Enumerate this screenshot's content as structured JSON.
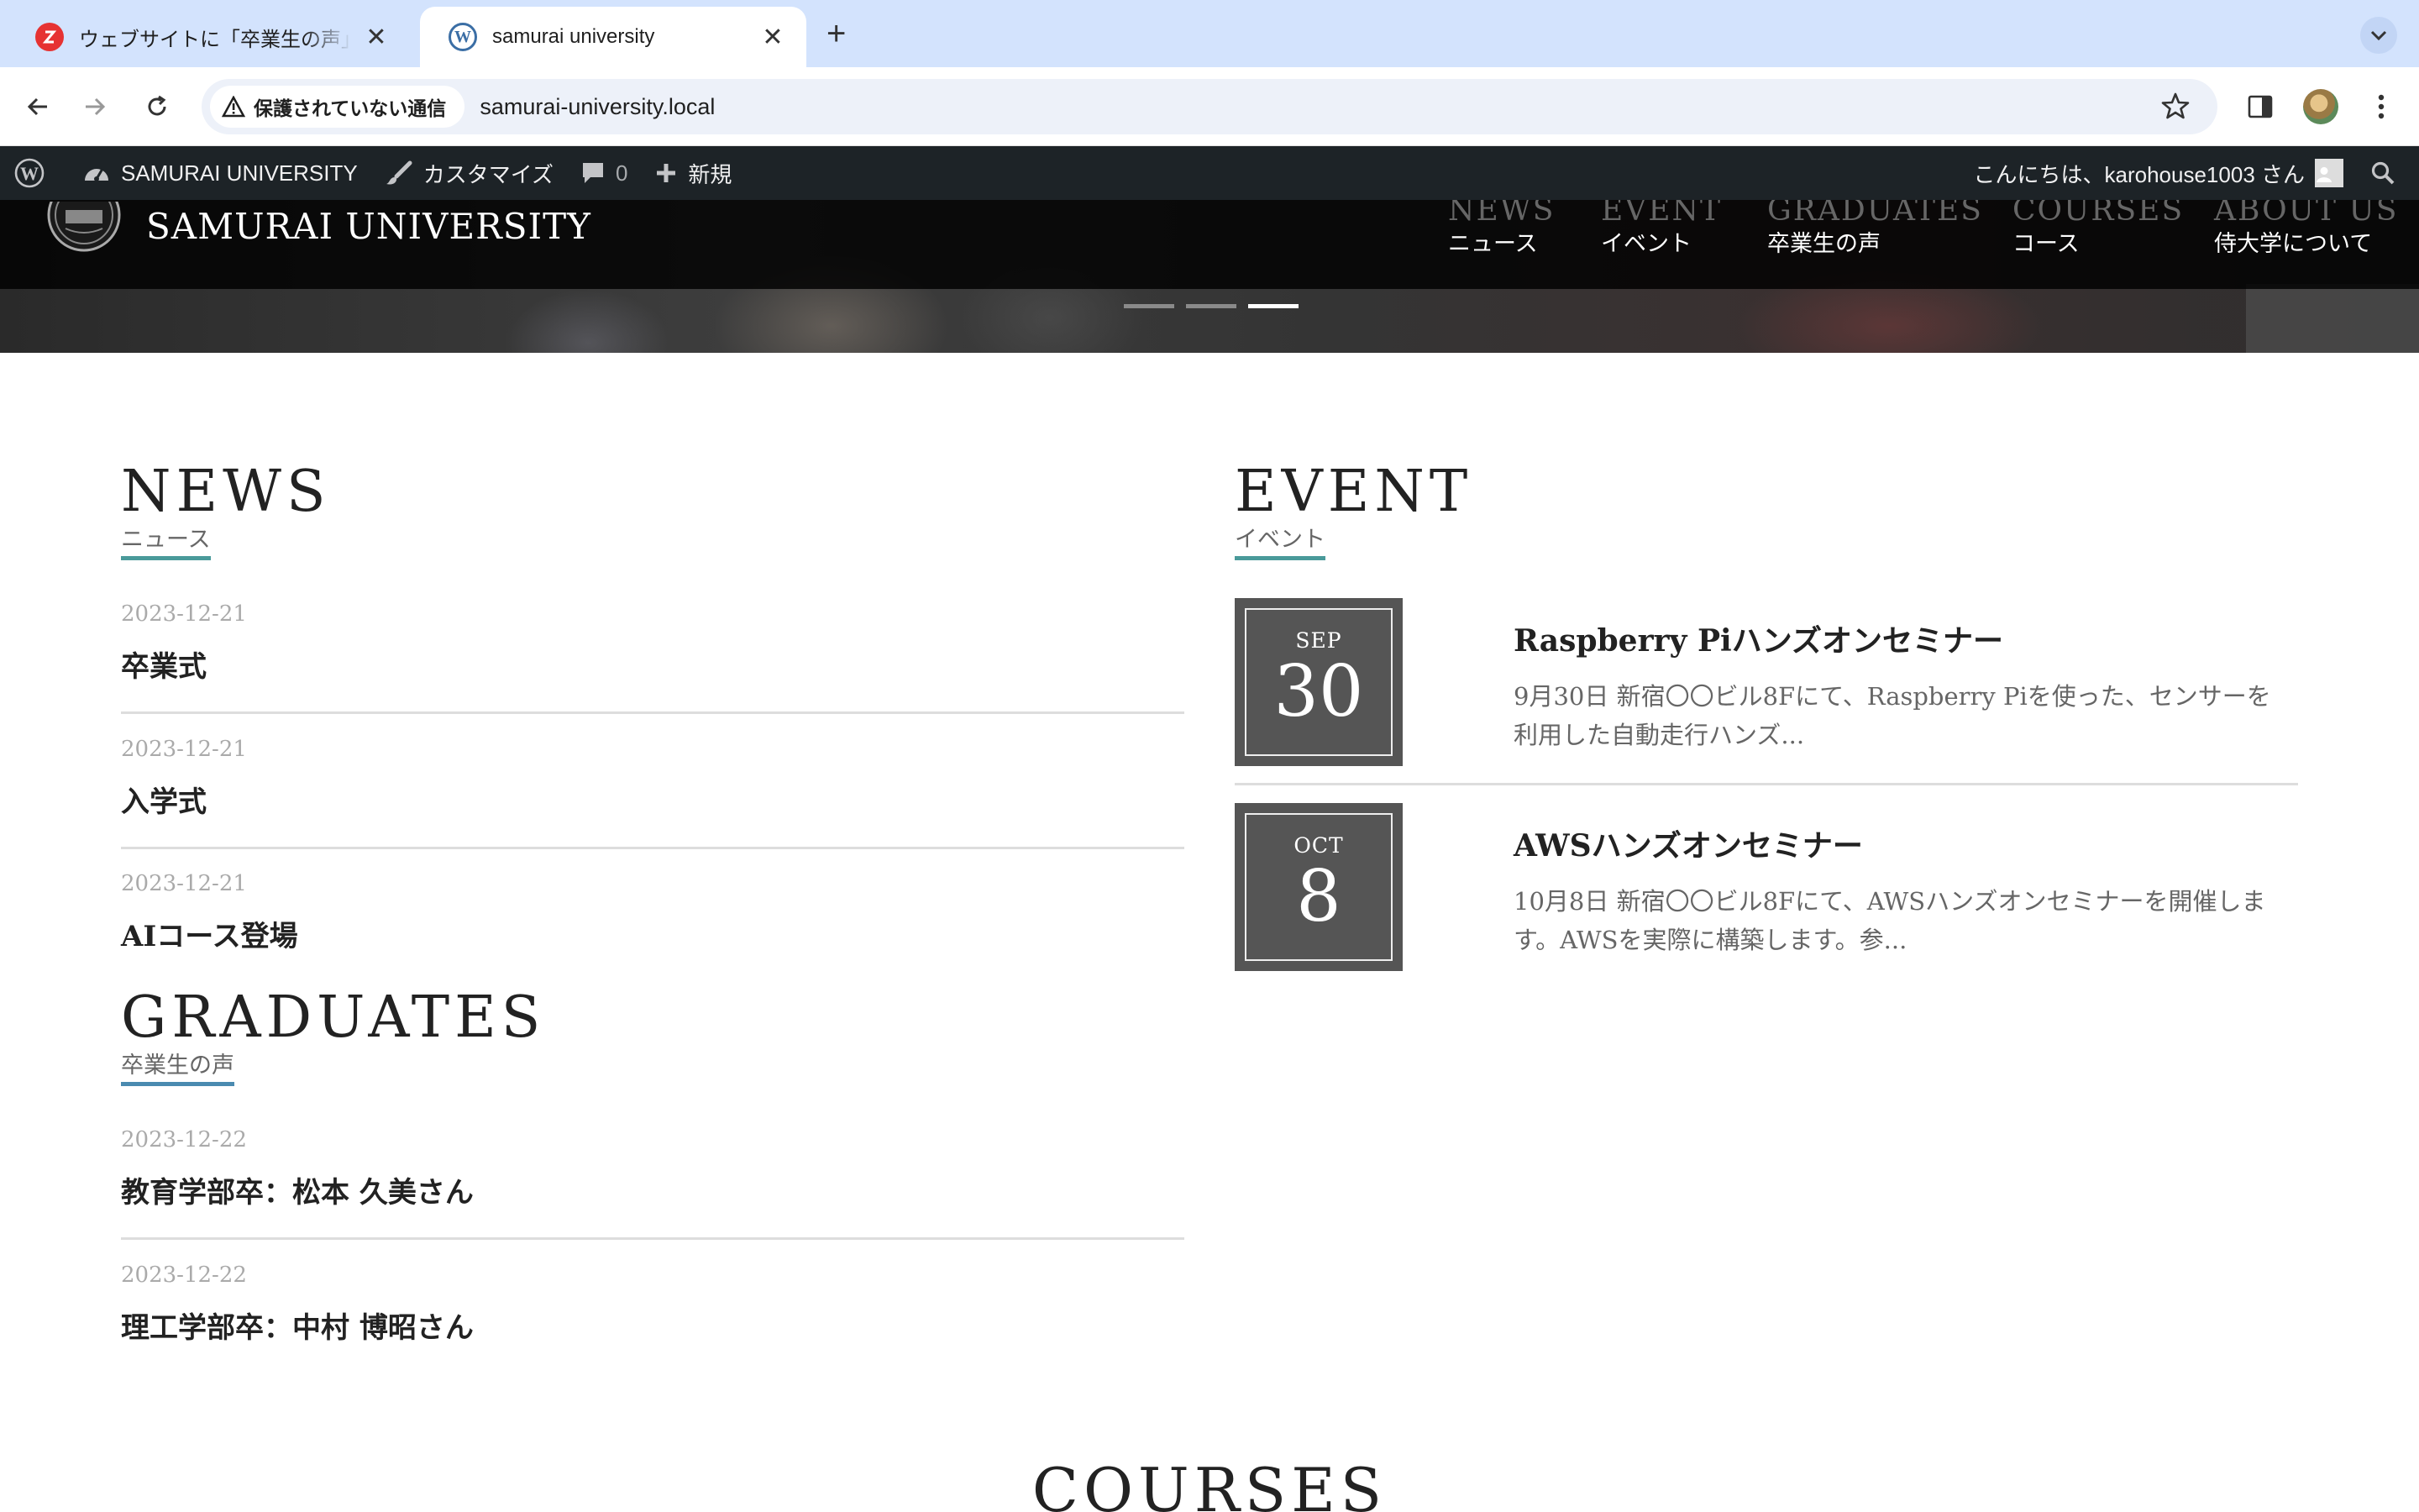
{
  "browser": {
    "tabs": [
      {
        "title": "ウェブサイトに「卒業生の声」投稿タイプを",
        "active": false
      },
      {
        "title": "samurai university",
        "active": true
      }
    ],
    "security_label": "保護されていない通信",
    "url": "samurai-university.local"
  },
  "adminbar": {
    "site_name": "SAMURAI UNIVERSITY",
    "customize": "カスタマイズ",
    "comments_count": "0",
    "new_label": "新規",
    "greeting": "こんにちは、karohouse1003 さん"
  },
  "header": {
    "site_title": "SAMURAI UNIVERSITY",
    "nav": [
      {
        "en": "NEWS",
        "ja": "ニュース"
      },
      {
        "en": "EVENT",
        "ja": "イベント"
      },
      {
        "en": "GRADUATES",
        "ja": "卒業生の声"
      },
      {
        "en": "COURSES",
        "ja": "コース"
      },
      {
        "en": "ABOUT US",
        "ja": "侍大学について"
      }
    ],
    "slider_active": 3
  },
  "news": {
    "heading": "NEWS",
    "sub": "ニュース",
    "posts": [
      {
        "date": "2023-12-21",
        "title": "卒業式"
      },
      {
        "date": "2023-12-21",
        "title": "入学式"
      },
      {
        "date": "2023-12-21",
        "title": "AIコース登場"
      }
    ]
  },
  "graduates": {
    "heading": "GRADUATES",
    "sub": "卒業生の声",
    "posts": [
      {
        "date": "2023-12-22",
        "title": "教育学部卒：松本 久美さん"
      },
      {
        "date": "2023-12-22",
        "title": "理工学部卒：中村 博昭さん"
      }
    ]
  },
  "event": {
    "heading": "EVENT",
    "sub": "イベント",
    "items": [
      {
        "month": "SEP",
        "day": "30",
        "title": "Raspberry Piハンズオンセミナー",
        "desc": "9月30日 新宿〇〇ビル8Fにて、Raspberry Piを使った、センサーを利用した自動走行ハンズ..."
      },
      {
        "month": "OCT",
        "day": "8",
        "title": "AWSハンズオンセミナー",
        "desc": "10月8日 新宿〇〇ビル8Fにて、AWSハンズオンセミナーを開催します。AWSを実際に構築します。参..."
      }
    ]
  },
  "courses": {
    "heading": "COURSES"
  }
}
